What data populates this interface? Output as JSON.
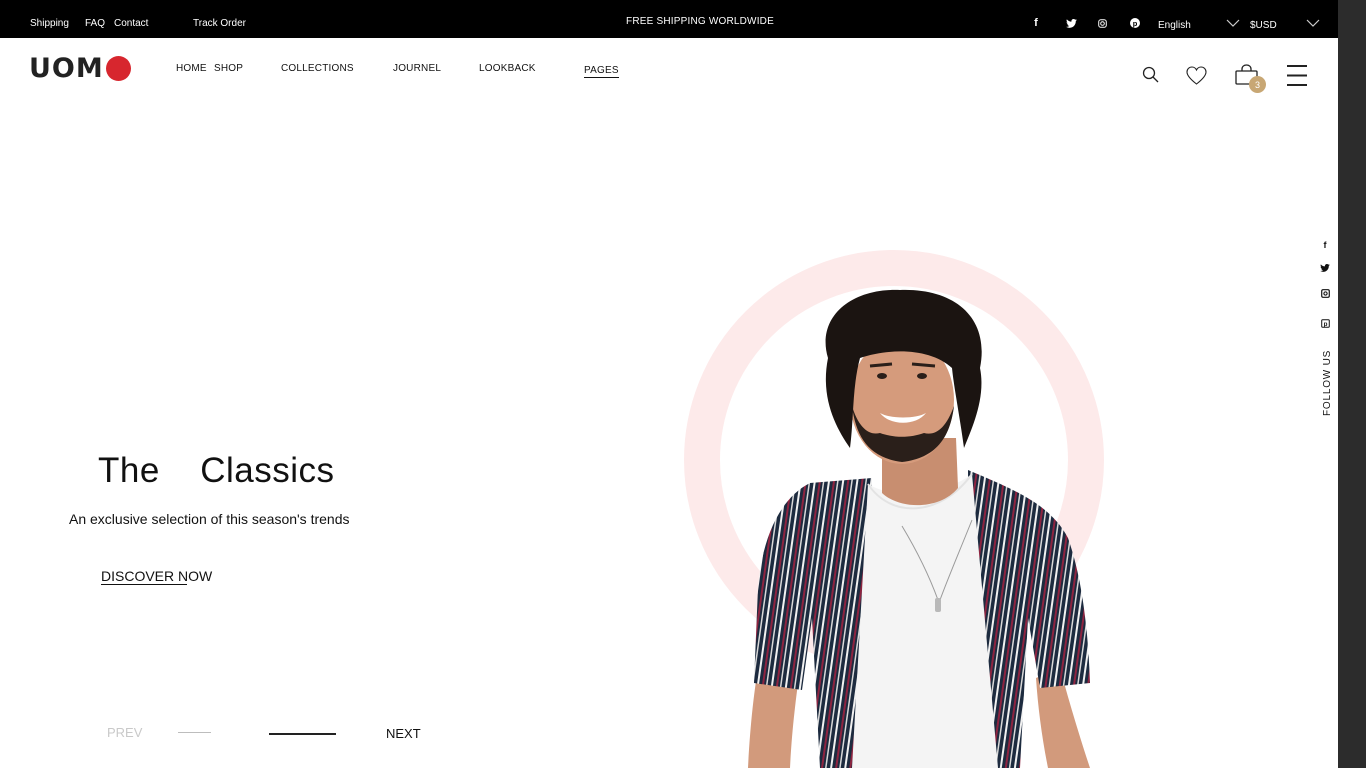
{
  "topbar": {
    "links": [
      "Shipping",
      "FAQ",
      "Contact",
      "Track Order"
    ],
    "announcement": "FREE SHIPPING WORLDWIDE",
    "social_icons": [
      "facebook-icon",
      "twitter-icon",
      "instagram-icon",
      "pinterest-icon"
    ],
    "language": "English",
    "currency": "$USD"
  },
  "header": {
    "logo_text": "UOM",
    "nav": [
      "HOME",
      "SHOP",
      "COLLECTIONS",
      "JOURNEL",
      "LOOKBACK",
      "PAGES"
    ],
    "active_nav": "PAGES",
    "cart_count": "3",
    "icons": [
      "search-icon",
      "heart-icon",
      "cart-icon",
      "menu-icon"
    ]
  },
  "hero": {
    "title": "The  Classics",
    "subtitle": "An exclusive selection of this season's trends",
    "cta": "DISCOVER NOW",
    "prev": "PREV",
    "next": "NEXT"
  },
  "sidebar": {
    "follow_label": "FOLLOW US",
    "icons": [
      "facebook-icon",
      "twitter-icon",
      "instagram-icon",
      "pinterest-icon"
    ]
  },
  "colors": {
    "topbar_bg": "#000000",
    "brand_red": "#d7262e",
    "ring_pink": "#fdeaea",
    "badge_gold": "#c8a774"
  }
}
